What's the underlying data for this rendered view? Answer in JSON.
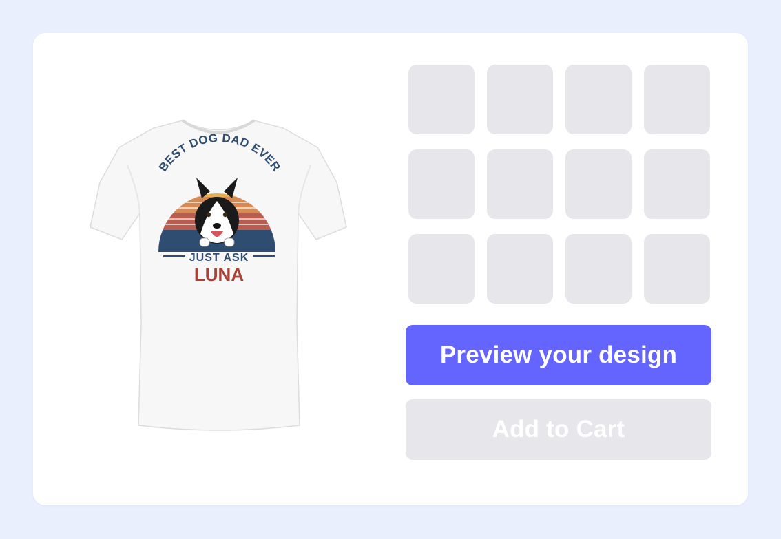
{
  "product": {
    "image_alt": "White t-shirt with husky dog print",
    "print_arc_text": "BEST DOG DAD EVER",
    "print_sub_text": "JUST ASK",
    "print_name": "LUNA"
  },
  "options_grid": {
    "rows": 3,
    "columns": 4,
    "thumbnails": [
      "",
      "",
      "",
      "",
      "",
      "",
      "",
      "",
      "",
      "",
      "",
      ""
    ]
  },
  "actions": {
    "preview_label": "Preview your design",
    "cart_label": "Add to Cart"
  },
  "colors": {
    "page_background": "#e9effd",
    "card_background": "#ffffff",
    "thumbnail_placeholder": "#e6e6eb",
    "primary_button": "#6464fe",
    "disabled_button": "#e6e6eb",
    "print_navy": "#2f4d70",
    "print_name_red": "#a84236"
  }
}
